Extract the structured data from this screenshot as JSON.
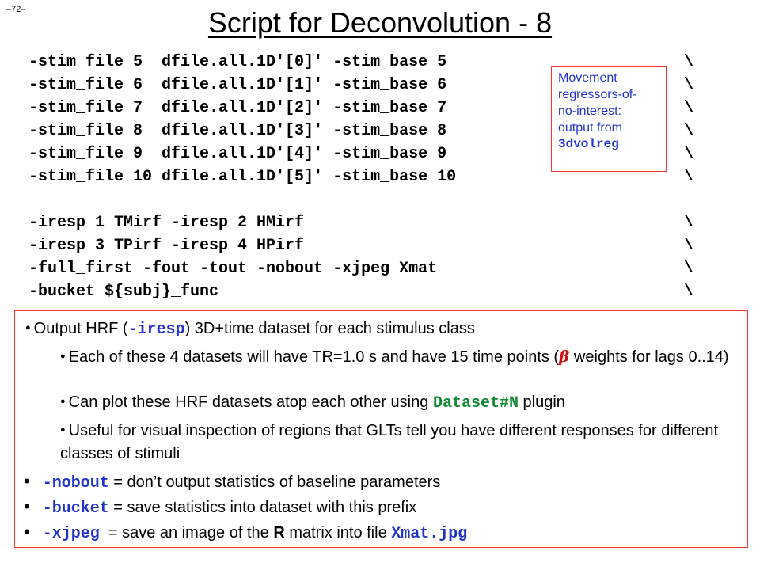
{
  "page_number": "–72–",
  "title": "Script for Deconvolution - 8",
  "code_lines_a": [
    {
      "text": "-stim_file 5  dfile.all.1D'[0]' -stim_base 5",
      "cont": "\\"
    },
    {
      "text": "-stim_file 6  dfile.all.1D'[1]' -stim_base 6",
      "cont": "\\"
    },
    {
      "text": "-stim_file 7  dfile.all.1D'[2]' -stim_base 7",
      "cont": "\\"
    },
    {
      "text": "-stim_file 8  dfile.all.1D'[3]' -stim_base 8",
      "cont": "\\"
    },
    {
      "text": "-stim_file 9  dfile.all.1D'[4]' -stim_base 9",
      "cont": "\\"
    },
    {
      "text": "-stim_file 10 dfile.all.1D'[5]' -stim_base 10",
      "cont": "\\"
    }
  ],
  "code_lines_b": [
    {
      "text": "-iresp 1 TMirf -iresp 2 HMirf",
      "cont": "\\"
    },
    {
      "text": "-iresp 3 TPirf -iresp 4 HPirf",
      "cont": "\\"
    },
    {
      "text": "-full_first -fout -tout -nobout -xjpeg Xmat",
      "cont": "\\"
    },
    {
      "text": "-bucket ${subj}_func",
      "cont": "\\"
    }
  ],
  "note": {
    "lines": [
      "Movement",
      "regressors-of-",
      "no-interest:",
      "output from"
    ],
    "program": "3dvolreg"
  },
  "bullet1": {
    "pre": "Output HRF (",
    "kw": "-iresp",
    "post": ") 3D+time dataset for each stimulus class"
  },
  "sub1": {
    "pre": "Each of these 4 datasets will have TR=1.0 s and have 15 time points (",
    "beta": "β",
    "post": " weights for lags 0..14)"
  },
  "sub2": {
    "pre": "Can plot these HRF datasets atop each other using ",
    "kw": "Dataset#N",
    "post": " plugin"
  },
  "sub3": {
    "text": "Useful for visual inspection of regions that GLTs tell you have different responses for different classes of stimuli"
  },
  "bottom_bullets": [
    {
      "kw": "-nobout",
      "pre": " = don’t output statistics of baseline parameters"
    },
    {
      "kw": "-bucket",
      "pre": " = save statistics into dataset with this prefix"
    },
    {
      "kw": "-xjpeg",
      "pre": "  = save an image of the ",
      "bold": "R",
      "post": " matrix into file ",
      "kw2": "Xmat.jpg"
    }
  ]
}
